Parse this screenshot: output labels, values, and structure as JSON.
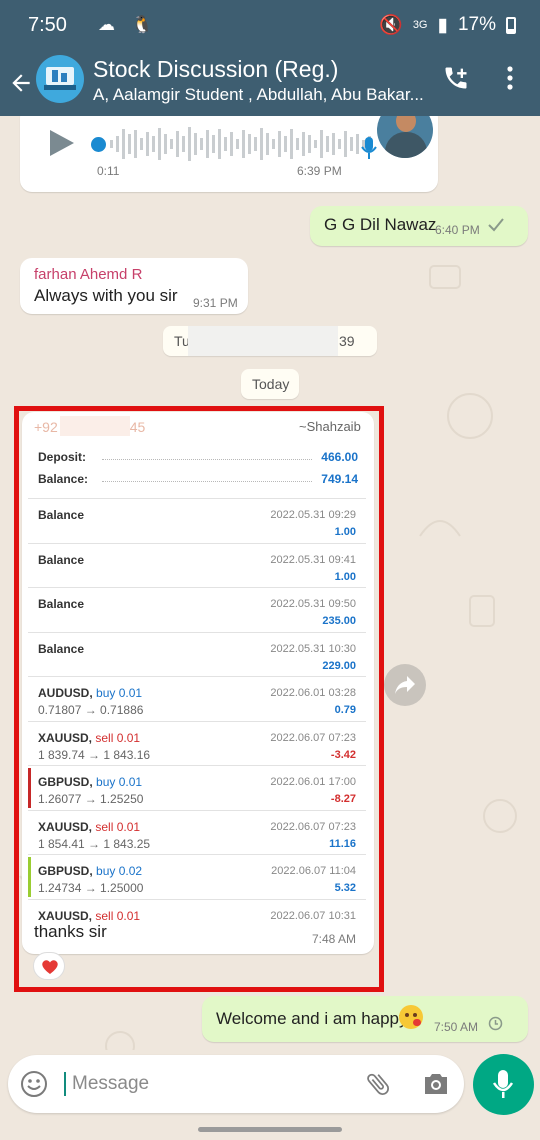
{
  "status_bar": {
    "time": "7:50",
    "network": "3G",
    "battery": "17%"
  },
  "header": {
    "back_icon": "arrow-left-icon",
    "title": "Stock Discussion (Reg.)",
    "members": "A, Aalamgir Student , Abdullah, Abu Bakar...",
    "actions": [
      "add-call-icon",
      "more-vert-icon"
    ]
  },
  "voice_note": {
    "duration": "0:11",
    "time": "6:39 PM"
  },
  "messages": {
    "gg": {
      "text": "G G Dil Nawaz",
      "time": "6:40 PM",
      "status": "sent"
    },
    "farhan": {
      "sender": "farhan Ahemd R",
      "text": "Always with you sir",
      "time": "9:31 PM"
    },
    "date_partial": {
      "start": "Tu",
      "end": "39"
    },
    "today": "Today",
    "welcome": {
      "text": "Welcome and i am happy",
      "emoji": "face-blowing-kiss",
      "time": "7:50 AM",
      "status": "pending"
    }
  },
  "trade_message": {
    "sender_start": "+92",
    "sender_end": "45",
    "pushname": "~Shahzaib",
    "deposit_label": "Deposit:",
    "deposit": "466.00",
    "balance_label": "Balance:",
    "balance": "749.14",
    "rows": [
      {
        "symbol": "Balance",
        "direction": "",
        "lots": "",
        "prices": "",
        "date": "2022.05.31 09:29",
        "amount": "1.00",
        "sign": "pos",
        "mark": ""
      },
      {
        "symbol": "Balance",
        "direction": "",
        "lots": "",
        "prices": "",
        "date": "2022.05.31 09:41",
        "amount": "1.00",
        "sign": "pos",
        "mark": ""
      },
      {
        "symbol": "Balance",
        "direction": "",
        "lots": "",
        "prices": "",
        "date": "2022.05.31 09:50",
        "amount": "235.00",
        "sign": "pos",
        "mark": ""
      },
      {
        "symbol": "Balance",
        "direction": "",
        "lots": "",
        "prices": "",
        "date": "2022.05.31 10:30",
        "amount": "229.00",
        "sign": "pos",
        "mark": ""
      },
      {
        "symbol": "AUDUSD,",
        "direction": "buy",
        "lots": "0.01",
        "prices": "0.71807 → 0.71886",
        "date": "2022.06.01 03:28",
        "amount": "0.79",
        "sign": "pos",
        "mark": ""
      },
      {
        "symbol": "XAUUSD,",
        "direction": "sell",
        "lots": "0.01",
        "prices": "1 839.74 → 1 843.16",
        "date": "2022.06.07 07:23",
        "amount": "-3.42",
        "sign": "neg",
        "mark": ""
      },
      {
        "symbol": "GBPUSD,",
        "direction": "buy",
        "lots": "0.01",
        "prices": "1.26077 → 1.25250",
        "date": "2022.06.01 17:00",
        "amount": "-8.27",
        "sign": "neg",
        "mark": "red"
      },
      {
        "symbol": "XAUUSD,",
        "direction": "sell",
        "lots": "0.01",
        "prices": "1 854.41 → 1 843.25",
        "date": "2022.06.07 07:23",
        "amount": "11.16",
        "sign": "pos",
        "mark": ""
      },
      {
        "symbol": "GBPUSD,",
        "direction": "buy",
        "lots": "0.02",
        "prices": "1.24734 → 1.25000",
        "date": "2022.06.07 11:04",
        "amount": "5.32",
        "sign": "pos",
        "mark": "green"
      },
      {
        "symbol": "XAUUSD,",
        "direction": "sell",
        "lots": "0.01",
        "prices": "",
        "date": "2022.06.07 10:31",
        "amount": "",
        "sign": "pos",
        "mark": ""
      }
    ],
    "caption": "thanks sir",
    "time": "7:48 AM",
    "reaction": "heart-icon"
  },
  "composer": {
    "placeholder": "Message",
    "icons": [
      "smiley-icon",
      "paperclip-icon",
      "camera-icon",
      "mic-icon"
    ]
  },
  "colors": {
    "header": "#3e5e71",
    "chat_bg": "#efe7dd",
    "outgoing": "#e2f8c8",
    "accent": "#00a884",
    "annotation": "#e01010"
  }
}
